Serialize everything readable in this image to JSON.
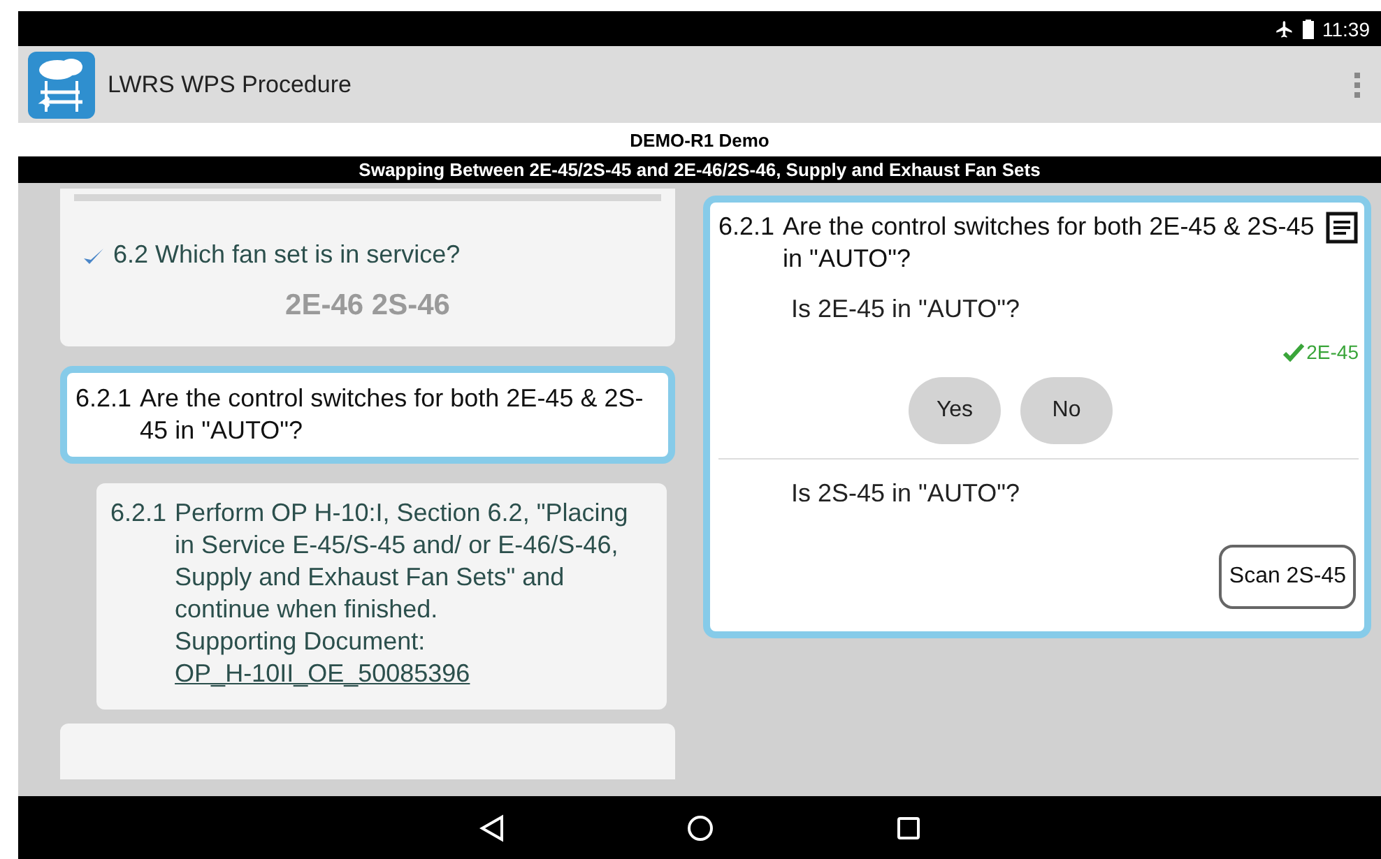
{
  "status_bar": {
    "time": "11:39",
    "airplane_mode": true
  },
  "app_bar": {
    "title": "LWRS WPS Procedure"
  },
  "header": {
    "procedure": "DEMO-R1 Demo",
    "section": "Swapping Between 2E-45/2S-45 and 2E-46/2S-46, Supply and Exhaust Fan Sets"
  },
  "steps": [
    {
      "kind": "answered",
      "selected": false,
      "text": "6.2 Which fan set is in service?",
      "answer": "2E-46 2S-46"
    },
    {
      "kind": "question",
      "selected": true,
      "number": "6.2.1",
      "text": "Are the control switches for both 2E-45 & 2S-45 in \"AUTO\"?"
    },
    {
      "kind": "instruction",
      "selected": false,
      "number": "6.2.1",
      "text": "Perform OP H-10:I, Section 6.2, \"Placing in Service E-45/S-45 and/ or E-46/S-46, Supply and Exhaust Fan Sets\" and continue when finished.",
      "doc_label": "Supporting Document:",
      "doc_link": "OP_H-10II_OE_50085396"
    },
    {
      "kind": "partial",
      "selected": false
    }
  ],
  "detail": {
    "number": "6.2.1",
    "text": "Are the control switches for both 2E-45 & 2S-45 in \"AUTO\"?",
    "checks": [
      {
        "kind": "buttons",
        "text": "Is 2E-45 in \"AUTO\"?",
        "confirmed": "2E-45",
        "buttons": [
          "Yes",
          "No"
        ]
      },
      {
        "kind": "scan",
        "text": "Is 2S-45 in \"AUTO\"?",
        "button": "Scan 2S-45"
      }
    ]
  }
}
